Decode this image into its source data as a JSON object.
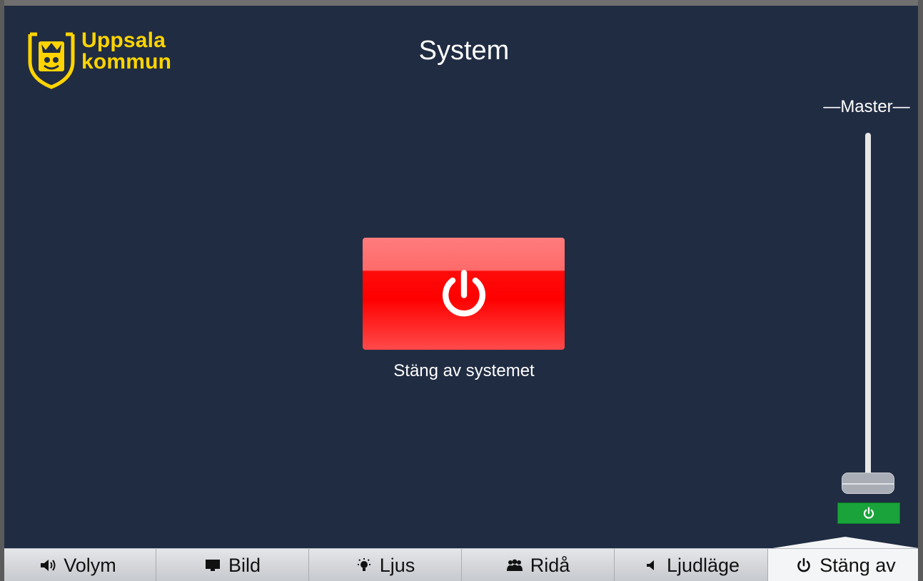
{
  "brand": {
    "name_line1": "Uppsala",
    "name_line2": "kommun",
    "color": "#ffd400"
  },
  "header": {
    "title": "System"
  },
  "volume": {
    "label": "—Master—",
    "level": 0.0,
    "mute_state": "on",
    "mute_color": "#1aa33b"
  },
  "main": {
    "power_label": "Stäng av systemet",
    "power_icon": "power-icon",
    "power_color": "#ff0000"
  },
  "tabs": [
    {
      "label": "Volym",
      "icon": "speaker-icon",
      "active": false
    },
    {
      "label": "Bild",
      "icon": "display-icon",
      "active": false
    },
    {
      "label": "Ljus",
      "icon": "lightbulb-icon",
      "active": false
    },
    {
      "label": "Ridå",
      "icon": "people-icon",
      "active": false
    },
    {
      "label": "Ljudläge",
      "icon": "audio-mode-icon",
      "active": false
    },
    {
      "label": "Stäng av",
      "icon": "power-icon",
      "active": true
    }
  ]
}
